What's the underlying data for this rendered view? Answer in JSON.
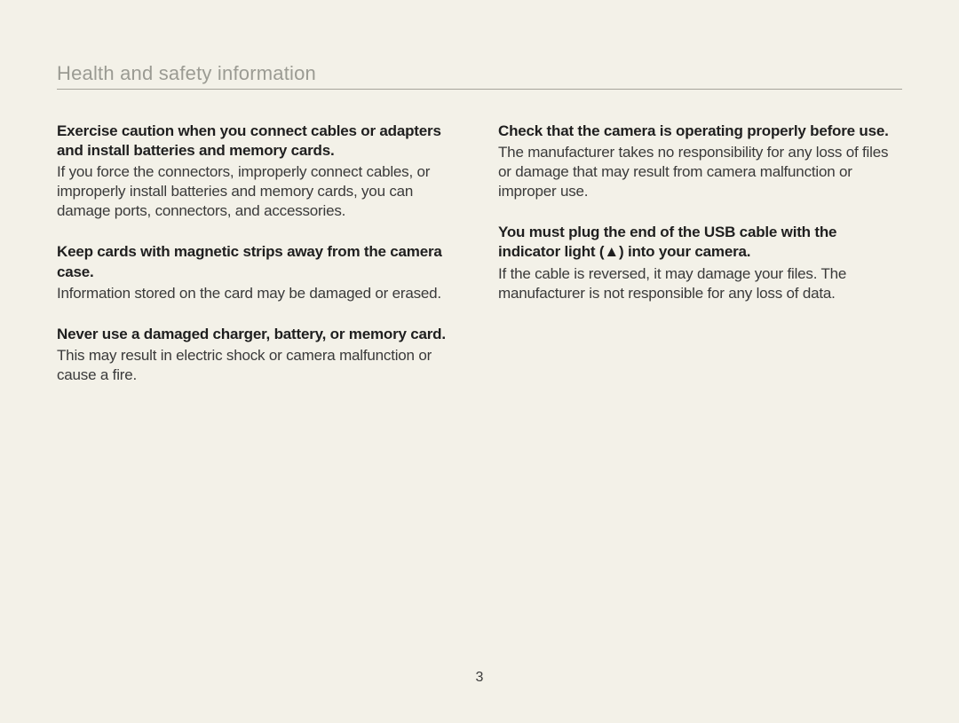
{
  "header": {
    "title": "Health and safety information"
  },
  "left": {
    "b1": {
      "heading": "Exercise caution when you connect cables or adapters and install batteries and memory cards.",
      "body": "If you force the connectors, improperly connect cables, or improperly install batteries and memory cards, you can damage ports, connectors, and accessories."
    },
    "b2": {
      "heading": "Keep cards with magnetic strips away from the camera case.",
      "body": "Information stored on the card may be damaged or erased."
    },
    "b3": {
      "heading": "Never use a damaged charger, battery, or memory card.",
      "body": "This may result in electric shock or camera malfunction or cause a fire."
    }
  },
  "right": {
    "b1": {
      "heading": "Check that the camera is operating properly before use.",
      "body": "The manufacturer takes no responsibility for any loss of files or damage that may result from camera malfunction or improper use."
    },
    "b2": {
      "heading": "You must plug the end of the USB cable with the indicator light (▲) into your camera.",
      "body": "If the cable is reversed, it may damage your files. The manufacturer is not responsible for any loss of data."
    }
  },
  "footer": {
    "page_number": "3"
  }
}
